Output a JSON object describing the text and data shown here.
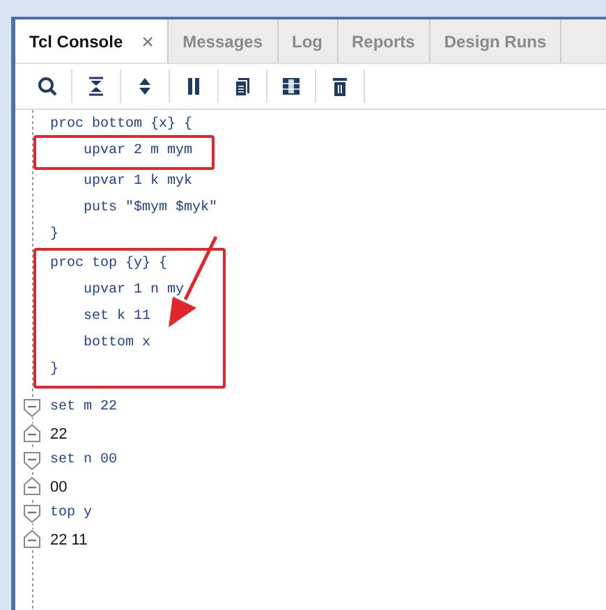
{
  "tabs": [
    {
      "label": "Tcl Console",
      "selected": true,
      "closable": true
    },
    {
      "label": "Messages",
      "selected": false,
      "closable": false
    },
    {
      "label": "Log",
      "selected": false,
      "closable": false
    },
    {
      "label": "Reports",
      "selected": false,
      "closable": false
    },
    {
      "label": "Design Runs",
      "selected": false,
      "closable": false
    }
  ],
  "console": {
    "blocks": [
      {
        "kind": "plain",
        "lines": [
          "proc bottom {x} {"
        ]
      },
      {
        "kind": "boxed",
        "lines": [
          "    upvar 2 m mym"
        ]
      },
      {
        "kind": "plain",
        "lines": [
          "    upvar 1 k myk",
          "    puts \"$mym $myk\"",
          "}"
        ]
      },
      {
        "kind": "boxed",
        "lines": [
          "proc top {y} {",
          "    upvar 1 n my",
          "    set k 11",
          "    bottom x",
          "}"
        ]
      }
    ],
    "entries": [
      {
        "kind": "command",
        "text": "set m 22"
      },
      {
        "kind": "output",
        "text": "22"
      },
      {
        "kind": "command",
        "text": "set n 00"
      },
      {
        "kind": "output",
        "text": "00"
      },
      {
        "kind": "command",
        "text": "top y"
      },
      {
        "kind": "output",
        "text": "22 11"
      }
    ],
    "annotation_arrow": true
  }
}
